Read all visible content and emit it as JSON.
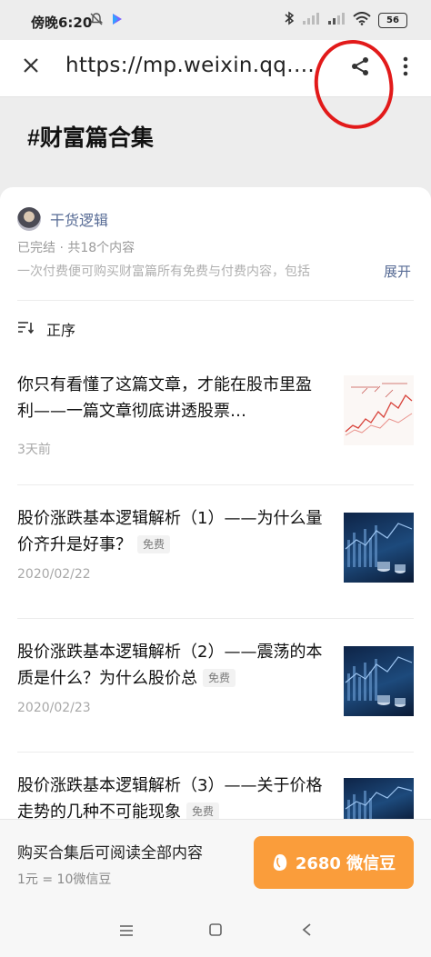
{
  "status_bar": {
    "time": "傍晚6:20",
    "battery": "56"
  },
  "nav": {
    "url": "https://mp.weixin.qq.com/"
  },
  "page": {
    "title": "#财富篇合集"
  },
  "collection": {
    "author": "干货逻辑",
    "meta": "已完结 · 共18个内容",
    "description": "一次付费便可购买财富篇所有免费与付费内容，包括",
    "expand_label": "展开",
    "sort_label": "正序"
  },
  "articles": [
    {
      "title": "你只有看懂了这篇文章，才能在股市里盈利——一篇文章彻底讲透股票…",
      "badge": "",
      "date": "3天前"
    },
    {
      "title": "股价涨跌基本逻辑解析（1）——为什么量价齐升是好事？",
      "badge": "免费",
      "date": "2020/02/22"
    },
    {
      "title": "股价涨跌基本逻辑解析（2）——震荡的本质是什么？为什么股价总",
      "badge": "免费",
      "date": "2020/02/23"
    },
    {
      "title": "股价涨跌基本逻辑解析（3）——关于价格走势的几种不可能现象",
      "badge": "免费",
      "date": ""
    }
  ],
  "buy_bar": {
    "main_text": "购买合集后可阅读全部内容",
    "sub_text": "1元 = 10微信豆",
    "button_label": "2680 微信豆"
  },
  "colors": {
    "link": "#576b95",
    "buy_button": "#fa9d3b",
    "annotation": "#e21a1a"
  },
  "icons": [
    "close-icon",
    "share-icon",
    "more-vertical-icon",
    "sort-icon",
    "bean-icon",
    "menu-icon",
    "home-square-icon",
    "back-icon"
  ]
}
